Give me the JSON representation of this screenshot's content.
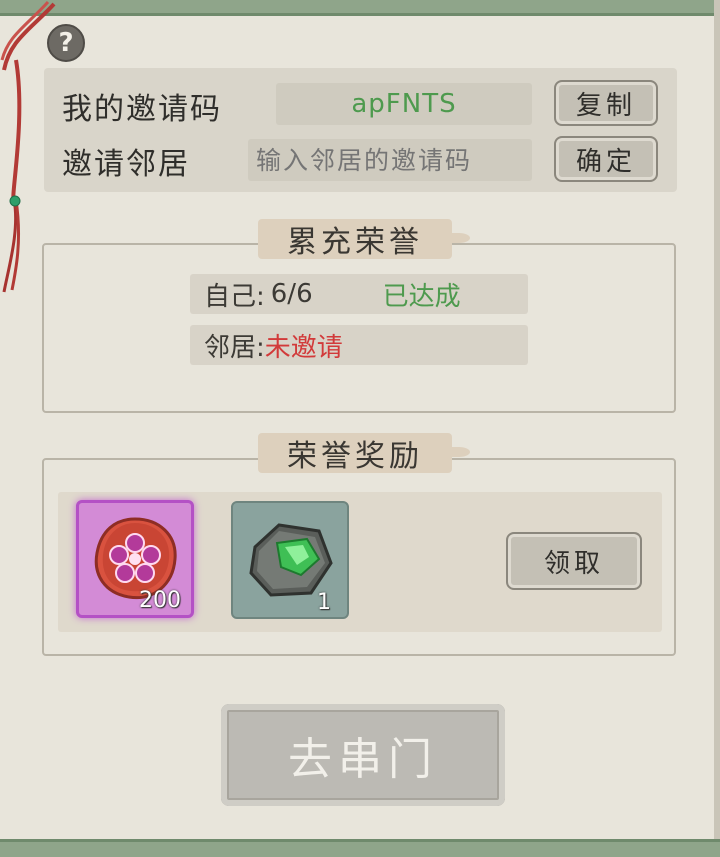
{
  "help": {
    "glyph": "?"
  },
  "invite": {
    "my_code_label": "我的邀请码",
    "my_code_value": "apFNTS",
    "copy_button": "复制",
    "invite_neighbor_label": "邀请邻居",
    "input_placeholder": "输入邻居的邀请码",
    "confirm_button": "确定"
  },
  "honor": {
    "title": "累充荣誉",
    "self_label": "自己:",
    "self_progress": "6/6",
    "self_status": "已达成",
    "neighbor_label": "邻居:",
    "neighbor_status": "未邀请"
  },
  "rewards": {
    "title": "荣誉奖励",
    "items": [
      {
        "icon": "plum-blossom-token-icon",
        "quantity": "200",
        "rarity_color": "#c46ad0"
      },
      {
        "icon": "jade-stone-icon",
        "quantity": "1",
        "rarity_color": "#8aa39e"
      }
    ],
    "claim_button": "领取"
  },
  "go_button": "去串门",
  "colors": {
    "success": "#4e9a4e",
    "warning": "#d23a3a"
  }
}
